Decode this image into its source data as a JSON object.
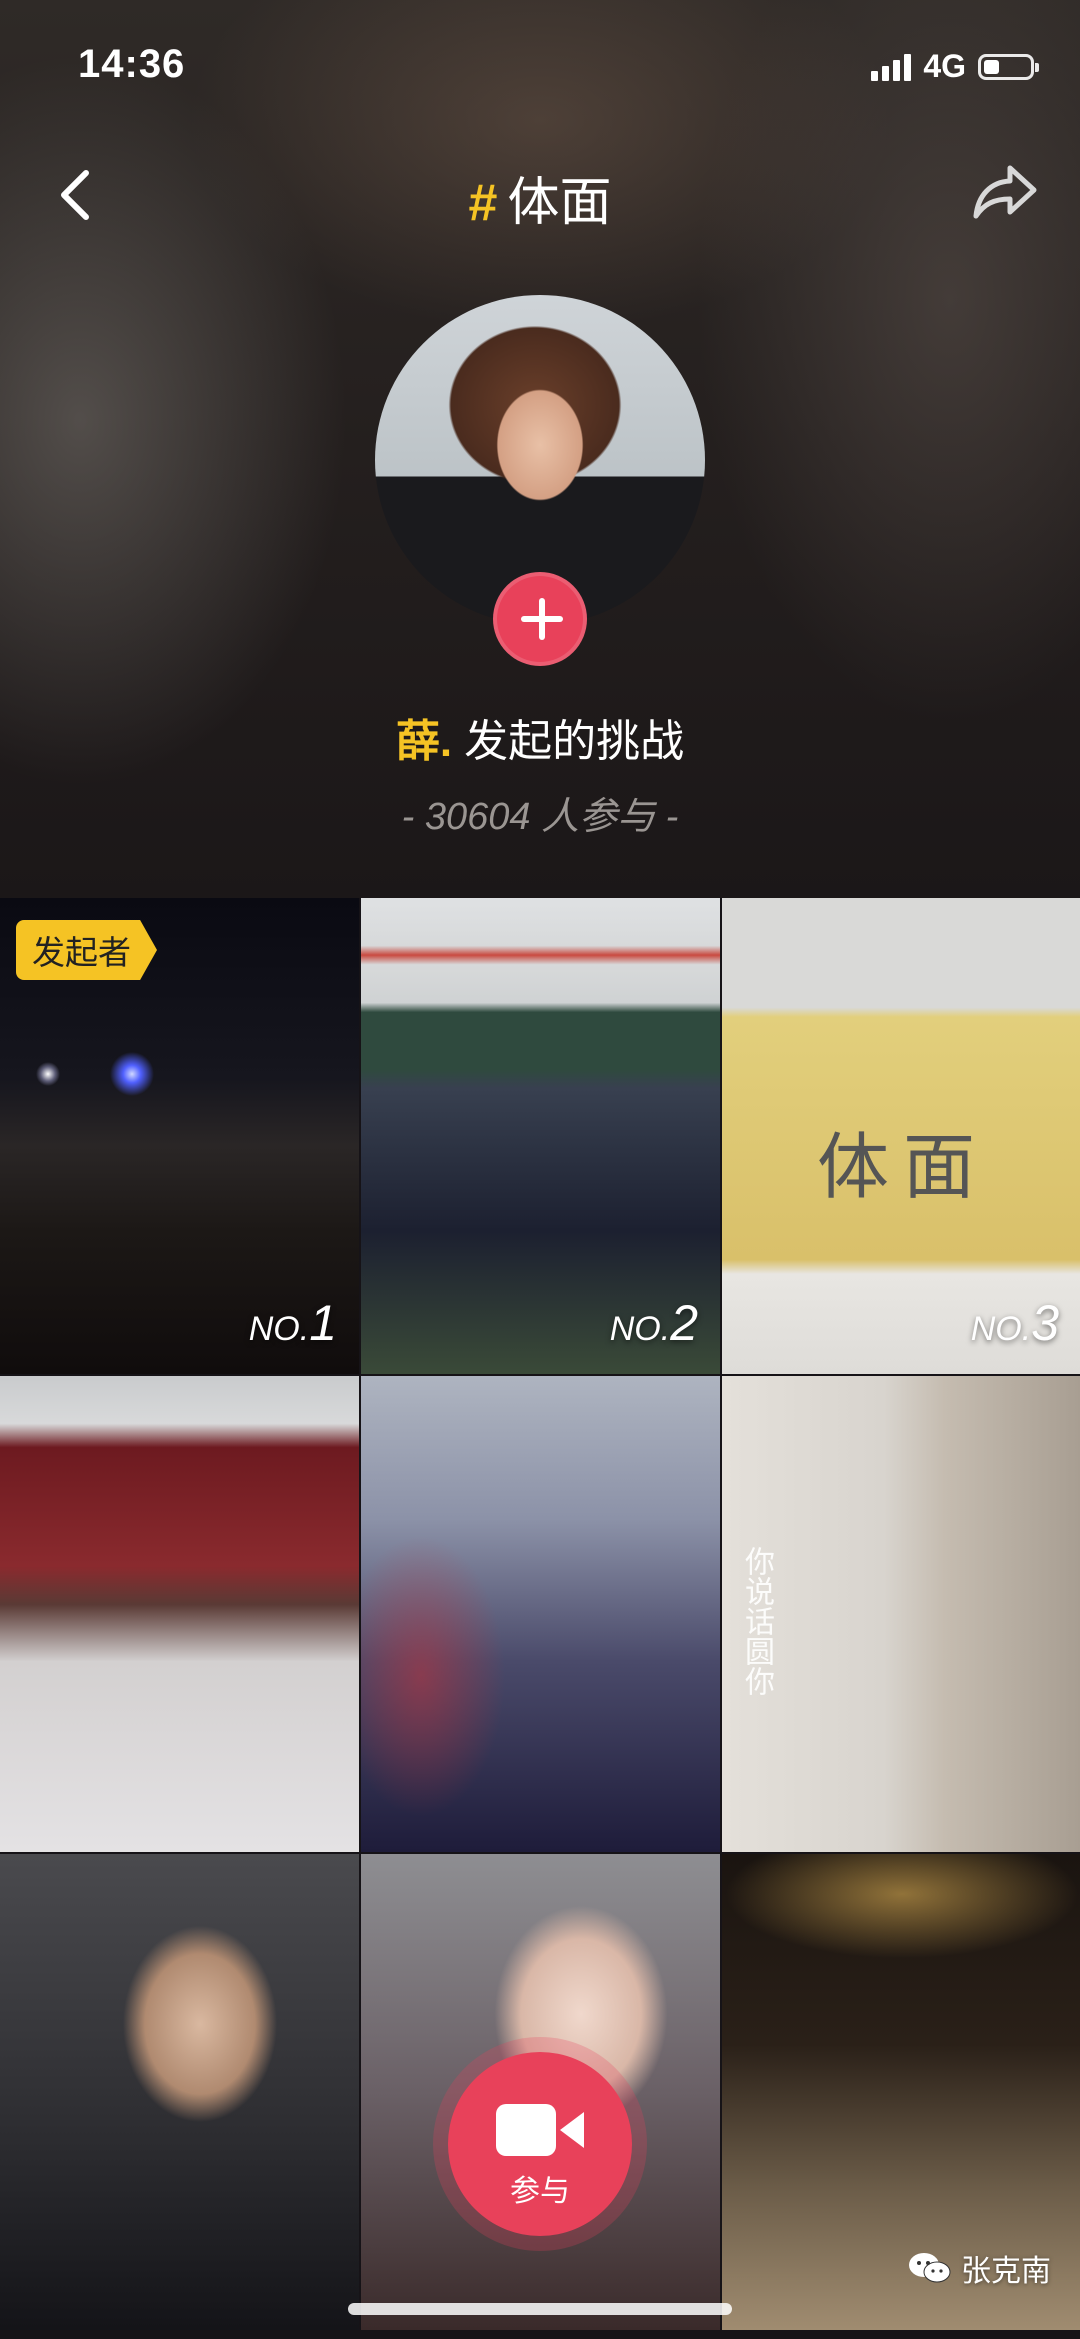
{
  "status_bar": {
    "time": "14:36",
    "network": "4G",
    "battery_level": 0.35
  },
  "header": {
    "title_hash": "#",
    "title": "体面",
    "back_icon": "chevron-left-icon",
    "share_icon": "share-arrow-icon"
  },
  "creator": {
    "name": "薛.",
    "action": "发起的挑战",
    "participants": "- 30604 人参与 -"
  },
  "grid": {
    "badge_label": "发起者",
    "rank_prefix": "NO.",
    "ranks": [
      "1",
      "2",
      "3"
    ],
    "note_text": "体面",
    "overlay_text": "你说话圆你"
  },
  "join_button": {
    "label": "参与",
    "icon": "video-camera-icon"
  },
  "watermark": {
    "text": "张克南",
    "icon": "wechat-icon"
  },
  "colors": {
    "accent_yellow": "#f5c324",
    "accent_red": "#e8415a"
  }
}
